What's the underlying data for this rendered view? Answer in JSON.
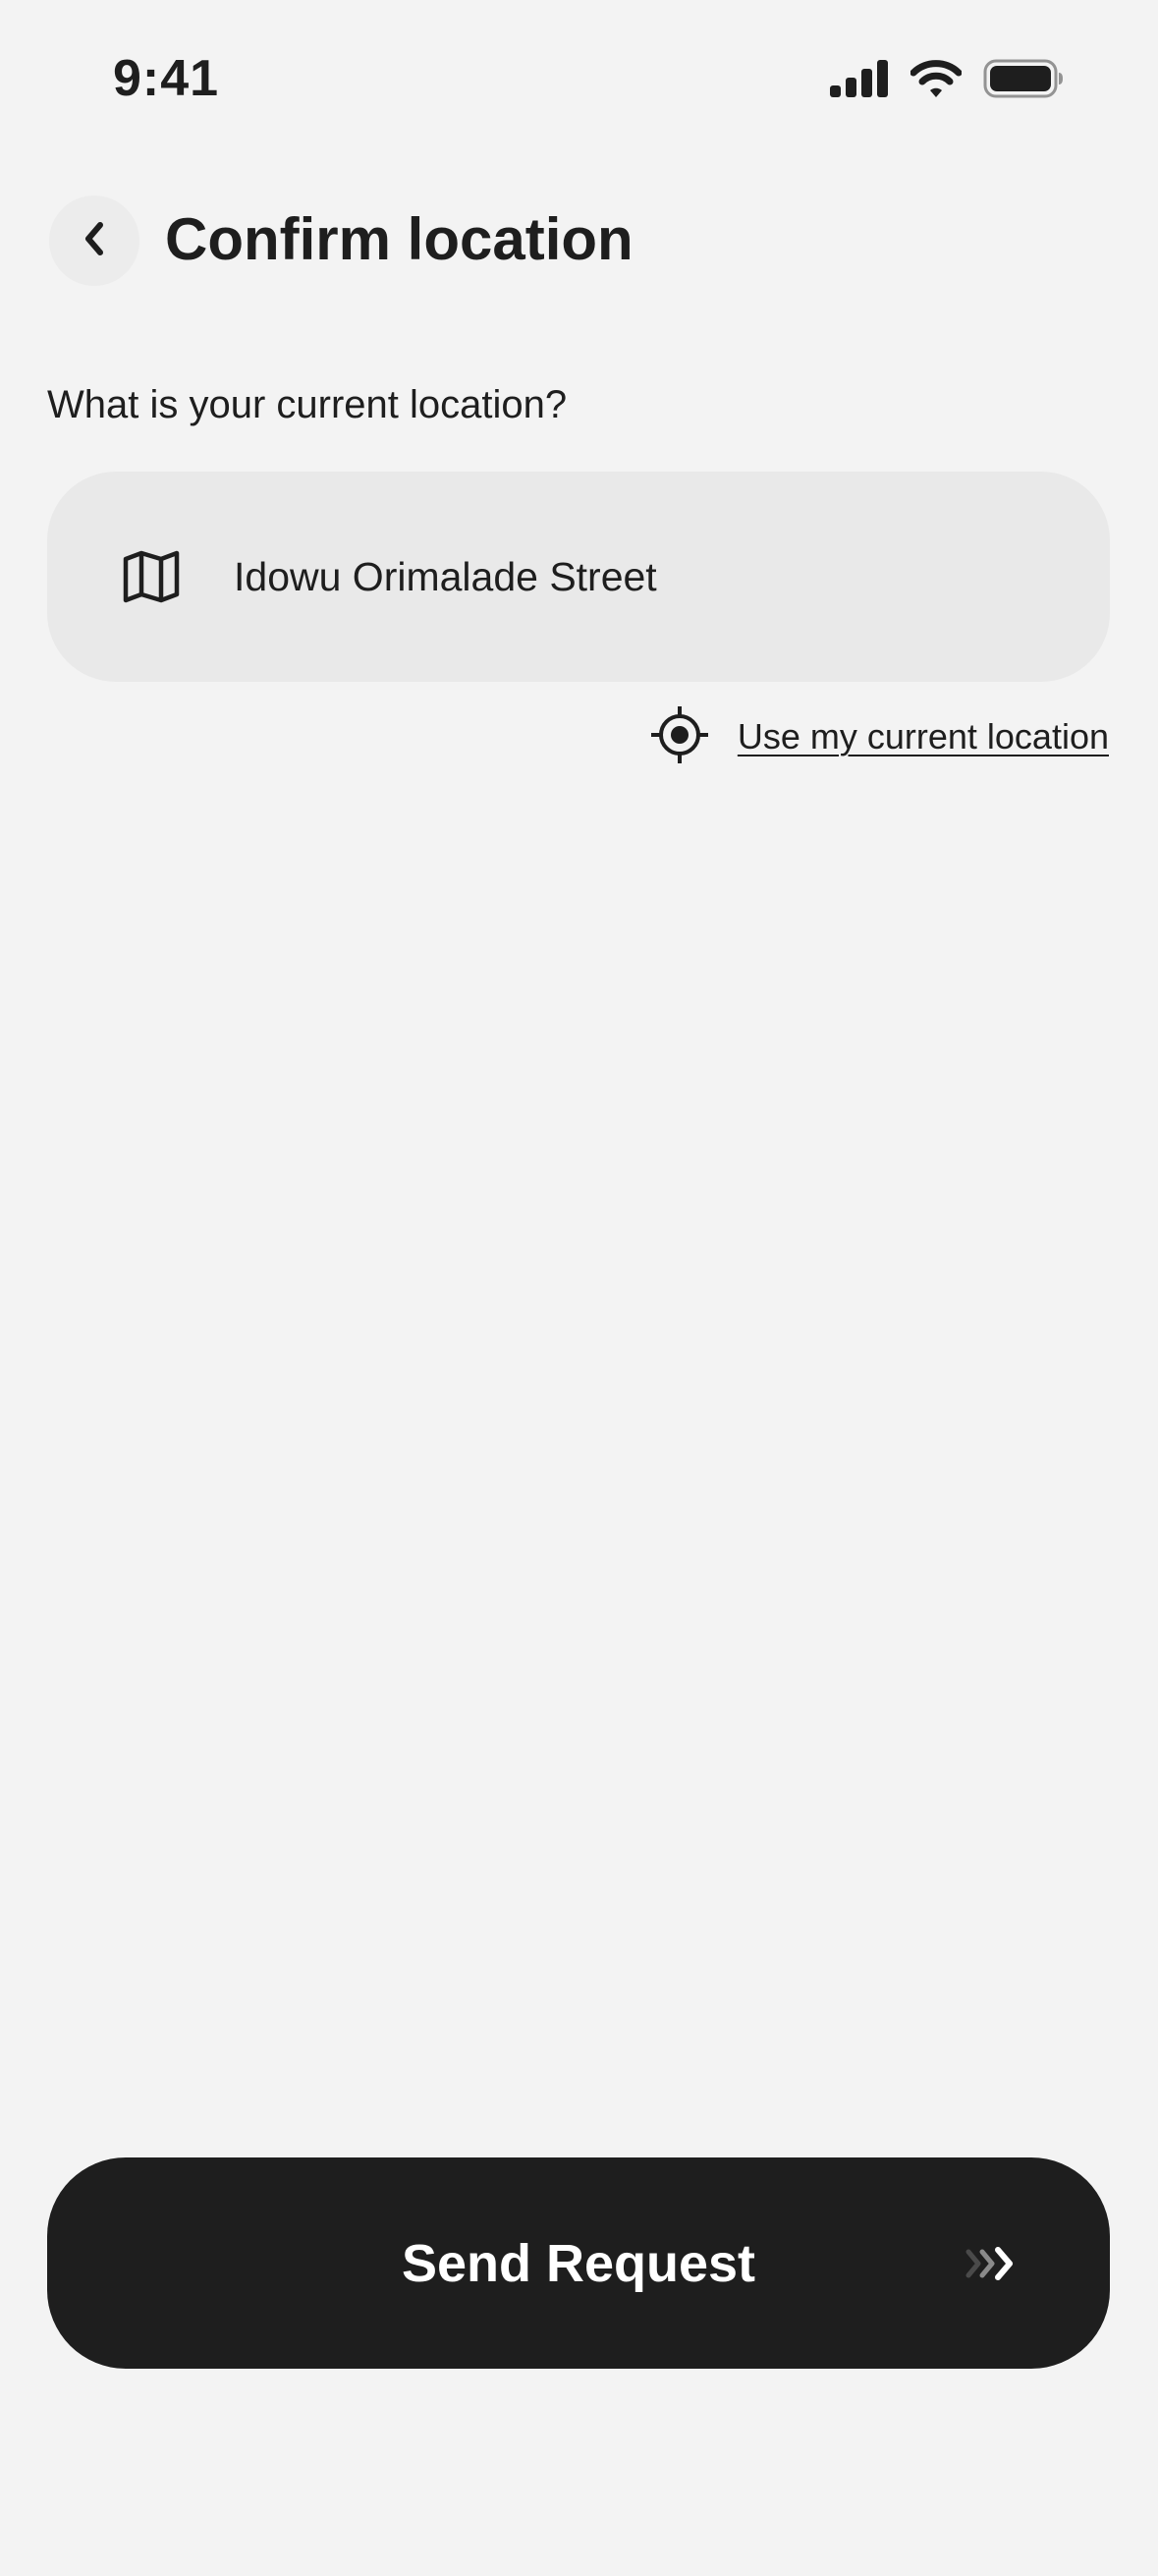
{
  "status_bar": {
    "time": "9:41",
    "icons": [
      "cellular-signal-icon",
      "wifi-icon",
      "battery-icon"
    ]
  },
  "header": {
    "back_icon": "chevron-left-icon",
    "title": "Confirm location"
  },
  "form": {
    "question": "What is your current location?",
    "location_icon": "map-icon",
    "location_value": "Idowu Orimalade Street",
    "use_current_icon": "crosshair-target-icon",
    "use_current_label": "Use my current location"
  },
  "footer": {
    "send_label": "Send Request",
    "send_icon": "double-chevron-right-icon"
  },
  "colors": {
    "background": "#f3f3f3",
    "field_background": "#e9e9e9",
    "primary_button": "#1e1e1e",
    "text": "#1e1e1e"
  }
}
